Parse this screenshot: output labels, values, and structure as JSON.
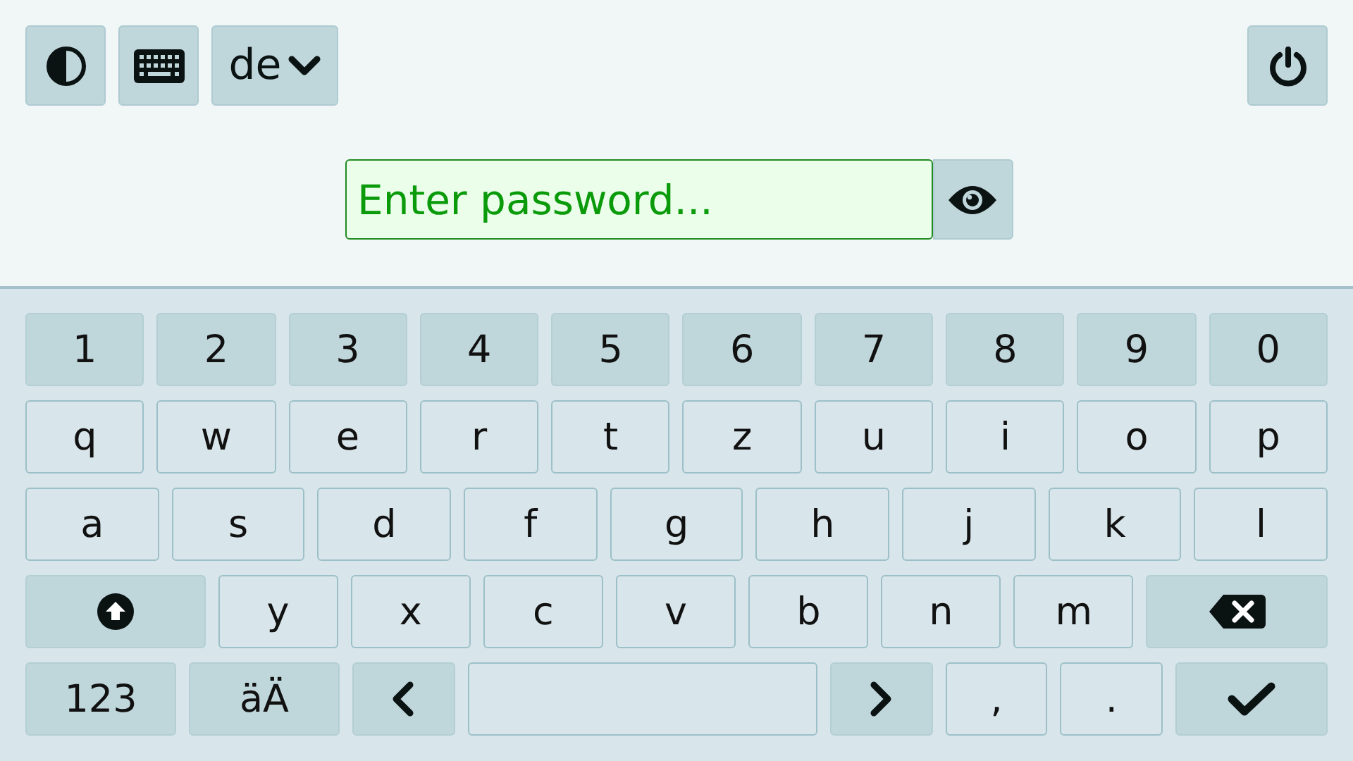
{
  "toolbar": {
    "left": [
      {
        "kind": "contrast"
      },
      {
        "kind": "keyboard"
      },
      {
        "kind": "language",
        "label": "de"
      }
    ],
    "right": [
      {
        "kind": "power"
      }
    ]
  },
  "password": {
    "placeholder": "Enter password..."
  },
  "keyboard": {
    "key_rows": [
      {
        "keys": [
          {
            "kind": "digit",
            "label": "1"
          },
          {
            "kind": "digit",
            "label": "2"
          },
          {
            "kind": "digit",
            "label": "3"
          },
          {
            "kind": "digit",
            "label": "4"
          },
          {
            "kind": "digit",
            "label": "5"
          },
          {
            "kind": "digit",
            "label": "6"
          },
          {
            "kind": "digit",
            "label": "7"
          },
          {
            "kind": "digit",
            "label": "8"
          },
          {
            "kind": "digit",
            "label": "9"
          },
          {
            "kind": "digit",
            "label": "0"
          }
        ]
      },
      {
        "keys": [
          {
            "kind": "letter",
            "label": "q"
          },
          {
            "kind": "letter",
            "label": "w"
          },
          {
            "kind": "letter",
            "label": "e"
          },
          {
            "kind": "letter",
            "label": "r"
          },
          {
            "kind": "letter",
            "label": "t"
          },
          {
            "kind": "letter",
            "label": "z"
          },
          {
            "kind": "letter",
            "label": "u"
          },
          {
            "kind": "letter",
            "label": "i"
          },
          {
            "kind": "letter",
            "label": "o"
          },
          {
            "kind": "letter",
            "label": "p"
          }
        ]
      },
      {
        "keys": [
          {
            "kind": "letter",
            "label": "a"
          },
          {
            "kind": "letter",
            "label": "s"
          },
          {
            "kind": "letter",
            "label": "d"
          },
          {
            "kind": "letter",
            "label": "f"
          },
          {
            "kind": "letter",
            "label": "g"
          },
          {
            "kind": "letter",
            "label": "h"
          },
          {
            "kind": "letter",
            "label": "j"
          },
          {
            "kind": "letter",
            "label": "k"
          },
          {
            "kind": "letter",
            "label": "l"
          }
        ]
      },
      {
        "keys": [
          {
            "kind": "shift"
          },
          {
            "kind": "letter",
            "label": "y"
          },
          {
            "kind": "letter",
            "label": "x"
          },
          {
            "kind": "letter",
            "label": "c"
          },
          {
            "kind": "letter",
            "label": "v"
          },
          {
            "kind": "letter",
            "label": "b"
          },
          {
            "kind": "letter",
            "label": "n"
          },
          {
            "kind": "letter",
            "label": "m"
          },
          {
            "kind": "backspace"
          }
        ]
      },
      {
        "keys": [
          {
            "kind": "mode",
            "label": "123"
          },
          {
            "kind": "mode",
            "label": "äÄ"
          },
          {
            "kind": "left"
          },
          {
            "kind": "space"
          },
          {
            "kind": "right"
          },
          {
            "kind": "letter",
            "label": ","
          },
          {
            "kind": "letter",
            "label": "."
          },
          {
            "kind": "enter"
          }
        ]
      }
    ]
  }
}
